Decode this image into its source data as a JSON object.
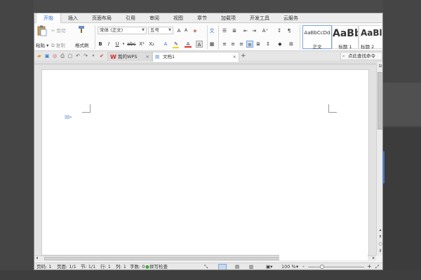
{
  "menu": {
    "tabs": [
      "开始",
      "插入",
      "页面布局",
      "引用",
      "审阅",
      "视图",
      "章节",
      "加载项",
      "开发工具",
      "云服务"
    ]
  },
  "ribbon": {
    "paste_label": "粘贴",
    "cut_label": "剪切",
    "copy_label": "复制",
    "format_painter_label": "格式刷",
    "font_name": "宋体 (正文)",
    "font_size": "五号",
    "styles": [
      {
        "sample": "AaBbCcDd",
        "name": "正文"
      },
      {
        "sample": "AaBb",
        "name": "标题 1"
      },
      {
        "sample": "AaBl",
        "name": "标题 2"
      }
    ]
  },
  "doc_tabs": {
    "wps_tab": "我的WPS",
    "doc_tab": "文档1",
    "close_glyph": "×",
    "new_tab_glyph": "+",
    "search_label": "点此查找命令"
  },
  "status": {
    "page_code": "页码: 1",
    "pages": "页面: 1/1",
    "section": "节: 1/1",
    "line": "行: 1",
    "column": "列: 1",
    "word_count": "字数: 0",
    "spell_check": "拼写检查",
    "zoom_text": "100 %",
    "zoom_minus": "-",
    "zoom_plus": "+",
    "zoom_level": 0.25
  },
  "colors": {
    "accent": "#2a6cd6",
    "highlight": "#f2d600",
    "font_color": "#e03030"
  }
}
